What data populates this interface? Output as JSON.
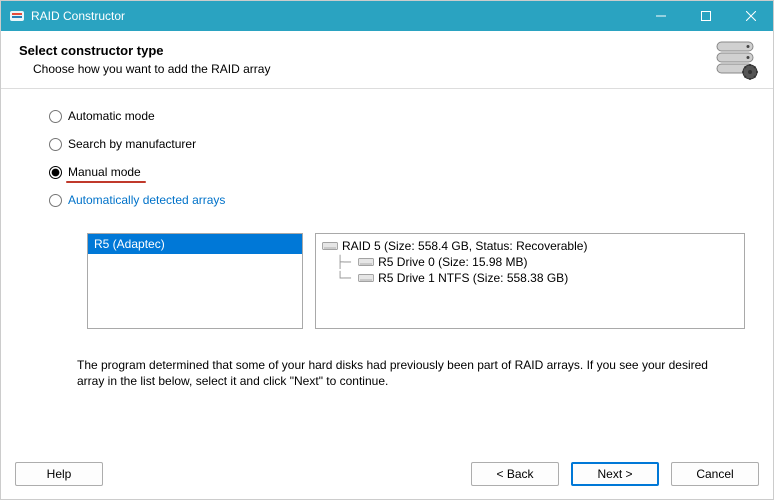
{
  "window": {
    "title": "RAID Constructor"
  },
  "header": {
    "title": "Select constructor type",
    "subtitle": "Choose how you want to add the RAID array"
  },
  "options": {
    "automatic": "Automatic mode",
    "search_manufacturer": "Search by manufacturer",
    "manual": "Manual mode",
    "auto_detected": "Automatically detected arrays",
    "selected": "manual"
  },
  "left_panel": {
    "item": "R5 (Adaptec)"
  },
  "tree": {
    "root": "RAID 5 (Size: 558.4 GB, Status: Recoverable)",
    "child0": "R5 Drive 0 (Size: 15.98 MB)",
    "child1": "R5 Drive 1 NTFS (Size: 558.38 GB)"
  },
  "description": "The program determined that some of your hard disks had previously been part of RAID arrays. If you see your desired array in the list below, select it and click \"Next\" to continue.",
  "buttons": {
    "help": "Help",
    "back": "< Back",
    "next": "Next >",
    "cancel": "Cancel"
  }
}
